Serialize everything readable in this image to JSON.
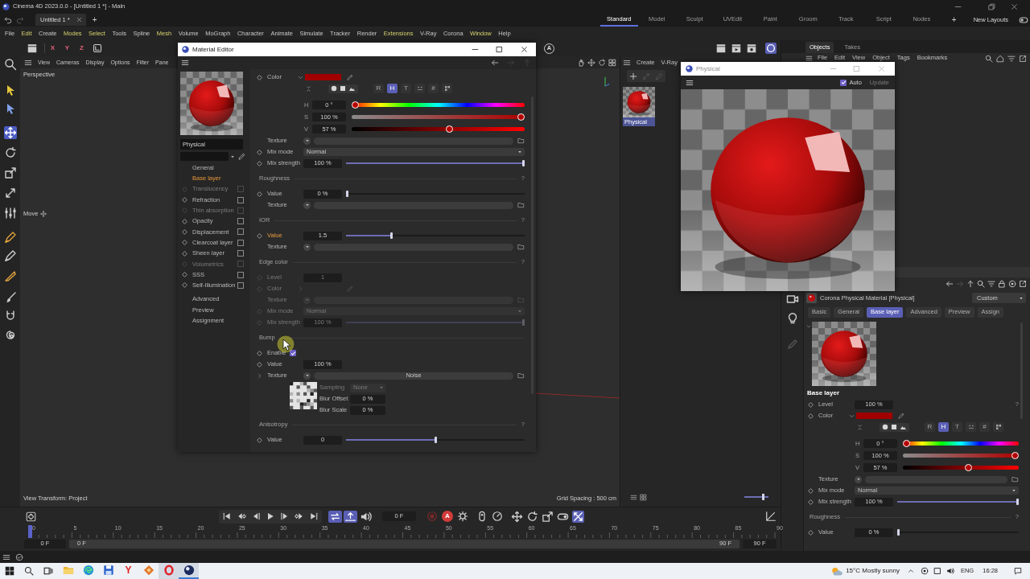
{
  "window": {
    "title": "Cinema 4D 2023.0.0 - [Untitled 1 *] - Main"
  },
  "document_tabs": [
    {
      "label": "Untitled 1 *",
      "selected": true
    }
  ],
  "new_tab": "+",
  "layouts": [
    {
      "label": "Standard",
      "selected": true
    },
    {
      "label": "Model",
      "selected": false
    },
    {
      "label": "Sculpt",
      "selected": false
    },
    {
      "label": "UVEdit",
      "selected": false
    },
    {
      "label": "Paint",
      "selected": false
    },
    {
      "label": "Groom",
      "selected": false
    },
    {
      "label": "Track",
      "selected": false
    },
    {
      "label": "Script",
      "selected": false
    },
    {
      "label": "Nodes",
      "selected": false
    }
  ],
  "add_layout": "+",
  "layout_menu": "New Layouts",
  "menu": [
    {
      "label": "File",
      "highlighted": false
    },
    {
      "label": "Edit",
      "highlighted": true
    },
    {
      "label": "Create",
      "highlighted": false
    },
    {
      "label": "Modes",
      "highlighted": true
    },
    {
      "label": "Select",
      "highlighted": true
    },
    {
      "label": "Tools",
      "highlighted": false
    },
    {
      "label": "Spline",
      "highlighted": false
    },
    {
      "label": "Mesh",
      "highlighted": true
    },
    {
      "label": "Volume",
      "highlighted": false
    },
    {
      "label": "MoGraph",
      "highlighted": false
    },
    {
      "label": "Character",
      "highlighted": false
    },
    {
      "label": "Animate",
      "highlighted": false
    },
    {
      "label": "Simulate",
      "highlighted": false
    },
    {
      "label": "Tracker",
      "highlighted": false
    },
    {
      "label": "Render",
      "highlighted": false
    },
    {
      "label": "Extensions",
      "highlighted": true
    },
    {
      "label": "V-Ray",
      "highlighted": false
    },
    {
      "label": "Corona",
      "highlighted": false
    },
    {
      "label": "Window",
      "highlighted": true
    },
    {
      "label": "Help",
      "highlighted": false
    }
  ],
  "toolbar": {
    "axes": [
      "X",
      "Y",
      "Z"
    ],
    "letter_button": "A",
    "render_tools": [
      {
        "on": false
      },
      {
        "on": false
      },
      {
        "on": false
      },
      {
        "on": true
      }
    ]
  },
  "tool_palette": [
    {
      "selected": false
    },
    {
      "selected": false
    },
    {
      "selected": false
    },
    {
      "selected": true
    },
    {
      "selected": false
    },
    {
      "selected": false
    },
    {
      "selected": false
    },
    {
      "selected": false
    },
    {
      "selected": false
    },
    {
      "selected": false
    },
    {
      "selected": false
    },
    {
      "selected": false
    },
    {
      "selected": false
    },
    {
      "selected": false
    }
  ],
  "viewport": {
    "menu": [
      "View",
      "Cameras",
      "Display",
      "Options",
      "Filter",
      "Pane"
    ],
    "camera": "Perspective",
    "active_tool": "Move",
    "view_transform": "View Transform: Project",
    "grid_spacing": "Grid Spacing : 500 cm"
  },
  "material_editor": {
    "title": "Material Editor",
    "name": "Physical",
    "sections": [
      {
        "kind": "page",
        "label": "General",
        "selected": false,
        "disabled": false
      },
      {
        "kind": "page",
        "label": "Base layer",
        "selected": true,
        "disabled": false
      },
      {
        "kind": "channel",
        "label": "Translucency",
        "checked": false,
        "selected": false,
        "disabled": true
      },
      {
        "kind": "channel",
        "label": "Refraction",
        "checked": false,
        "selected": false,
        "disabled": false
      },
      {
        "kind": "channel",
        "label": "Thin absorption",
        "checked": false,
        "selected": false,
        "disabled": true
      },
      {
        "kind": "channel",
        "label": "Opacity",
        "checked": false,
        "selected": false,
        "disabled": false
      },
      {
        "kind": "channel",
        "label": "Displacement",
        "checked": false,
        "selected": false,
        "disabled": false
      },
      {
        "kind": "channel",
        "label": "Clearcoat layer",
        "checked": false,
        "selected": false,
        "disabled": false
      },
      {
        "kind": "channel",
        "label": "Sheen layer",
        "checked": false,
        "selected": false,
        "disabled": false
      },
      {
        "kind": "channel",
        "label": "Volumetrics",
        "checked": false,
        "selected": false,
        "disabled": true
      },
      {
        "kind": "channel",
        "label": "SSS",
        "checked": false,
        "selected": false,
        "disabled": false
      },
      {
        "kind": "channel",
        "label": "Self-Illumination",
        "checked": false,
        "selected": false,
        "disabled": false
      },
      {
        "kind": "page",
        "label": "Advanced",
        "selected": false,
        "disabled": false
      },
      {
        "kind": "page",
        "label": "Preview",
        "selected": false,
        "disabled": false
      },
      {
        "kind": "page",
        "label": "Assignment",
        "selected": false,
        "disabled": false
      }
    ],
    "params": [
      {
        "kind": "color",
        "label": "Color",
        "color": "#a00000",
        "expanded": true,
        "disabled": false,
        "modified": false
      },
      {
        "kind": "modes",
        "buttons": [
          {
            "kind": "letter",
            "label": "R",
            "selected": false
          },
          {
            "kind": "letter",
            "label": "H",
            "selected": true
          },
          {
            "kind": "letter",
            "label": "T",
            "selected": false
          },
          {
            "kind": "icon",
            "selected": false
          },
          {
            "kind": "letter",
            "label": "#",
            "selected": false
          },
          {
            "kind": "icon",
            "selected": false
          }
        ]
      },
      {
        "kind": "hue_slider",
        "label": "H",
        "value": "0 °",
        "level": 0
      },
      {
        "kind": "saturation_slider",
        "label": "S",
        "value": "100 %",
        "level": 1
      },
      {
        "kind": "value_slider",
        "label": "V",
        "value": "57 %",
        "level": 0.57
      },
      {
        "kind": "texture",
        "label": "Texture",
        "disabled": false,
        "modified": false
      },
      {
        "kind": "dropdown",
        "label": "Mix mode",
        "value": "Normal",
        "disabled": false,
        "modified": false
      },
      {
        "kind": "slider",
        "label": "Mix strength",
        "value": "100 %",
        "level": 1,
        "disabled": false,
        "modified": false
      },
      {
        "kind": "section",
        "label": "Roughness",
        "help": "?"
      },
      {
        "kind": "slider",
        "label": "Value",
        "value": "0 %",
        "level": 0,
        "disabled": false,
        "modified": false
      },
      {
        "kind": "texture",
        "label": "Texture",
        "disabled": false,
        "modified": false
      },
      {
        "kind": "section",
        "label": "IOR",
        "help": "?"
      },
      {
        "kind": "slider",
        "label": "Value",
        "value": "1.5",
        "level": 0.25,
        "disabled": false,
        "modified": true
      },
      {
        "kind": "texture",
        "label": "Texture",
        "disabled": false,
        "modified": false
      },
      {
        "kind": "section",
        "label": "Edge color",
        "help": "?"
      },
      {
        "kind": "field",
        "label": "Level",
        "value": "1",
        "disabled": true,
        "modified": false
      },
      {
        "kind": "color",
        "label": "Color",
        "expanded": false,
        "disabled": true,
        "modified": false
      },
      {
        "kind": "texture",
        "label": "Texture",
        "disabled": true,
        "modified": false
      },
      {
        "kind": "dropdown",
        "label": "Mix mode",
        "value": "Normal",
        "disabled": true,
        "modified": false
      },
      {
        "kind": "slider",
        "label": "Mix strength",
        "value": "100 %",
        "level": 1,
        "disabled": true,
        "modified": false
      },
      {
        "kind": "section",
        "label": "Bump"
      },
      {
        "kind": "checkbox",
        "label": "Enable",
        "checked": true,
        "disabled": false,
        "modified": false
      },
      {
        "kind": "field",
        "label": "Value",
        "value": "100 %",
        "disabled": false,
        "modified": false
      },
      {
        "kind": "texture",
        "label": "Texture",
        "value": "Noise",
        "expanded": false,
        "disabled": false,
        "modified": false
      },
      {
        "kind": "noise",
        "fields": [
          {
            "kind": "dropdown",
            "label": "Sampling",
            "value": "None",
            "disabled": true
          },
          {
            "kind": "field",
            "label": "Blur Offset",
            "value": "0 %",
            "disabled": false
          },
          {
            "kind": "field",
            "label": "Blur Scale",
            "value": "0 %",
            "disabled": false
          }
        ]
      },
      {
        "kind": "section",
        "label": "Anisotropy",
        "help": "?"
      },
      {
        "kind": "slider",
        "label": "Value",
        "value": "0",
        "level": 0.5,
        "disabled": false,
        "modified": false
      }
    ]
  },
  "material_manager": {
    "menu": [
      "Create",
      "V-Ray"
    ],
    "materials": [
      {
        "name": "Physical",
        "selected": true
      }
    ],
    "zoom": {
      "level": 0.8
    }
  },
  "objects_panel": {
    "tabs": [
      {
        "label": "Objects",
        "selected": true
      },
      {
        "label": "Takes",
        "selected": false
      }
    ],
    "menu": [
      "File",
      "Edit",
      "View",
      "Object",
      "Tags",
      "Bookmarks"
    ]
  },
  "preview_window": {
    "title": "Physical",
    "auto": {
      "label": "Auto",
      "checked": true
    },
    "update": {
      "label": "Update",
      "disabled": true
    }
  },
  "attributes": {
    "title": "Corona Physical Material [Physical]",
    "mode": "Custom",
    "tabs": [
      {
        "label": "Basic",
        "selected": false
      },
      {
        "label": "General",
        "selected": false
      },
      {
        "label": "Base layer",
        "selected": true
      },
      {
        "label": "Advanced",
        "selected": false
      },
      {
        "label": "Preview",
        "selected": false
      },
      {
        "label": "Assign",
        "selected": false
      }
    ],
    "heading": "Base layer",
    "params": [
      {
        "kind": "field",
        "label": "Level",
        "value": "100 %",
        "help": "?",
        "disabled": false,
        "modified": false
      },
      {
        "kind": "color",
        "label": "Color",
        "color": "#a00000",
        "expanded": true,
        "disabled": false,
        "modified": false
      },
      {
        "kind": "modes",
        "buttons": [
          {
            "kind": "letter",
            "label": "R",
            "selected": false
          },
          {
            "kind": "letter",
            "label": "H",
            "selected": true
          },
          {
            "kind": "letter",
            "label": "T",
            "selected": false
          },
          {
            "kind": "icon",
            "selected": false
          },
          {
            "kind": "letter",
            "label": "#",
            "selected": false
          },
          {
            "kind": "icon",
            "selected": false
          }
        ]
      },
      {
        "kind": "hue_slider",
        "label": "H",
        "value": "0 °",
        "level": 0
      },
      {
        "kind": "saturation_slider",
        "label": "S",
        "value": "100 %",
        "level": 1
      },
      {
        "kind": "value_slider",
        "label": "V",
        "value": "57 %",
        "level": 0.57
      },
      {
        "kind": "texture",
        "label": "Texture",
        "disabled": false,
        "modified": false
      },
      {
        "kind": "dropdown",
        "label": "Mix mode",
        "value": "Normal",
        "disabled": false,
        "modified": false
      },
      {
        "kind": "slider",
        "label": "Mix strength",
        "value": "100 %",
        "level": 1,
        "disabled": false,
        "modified": false
      },
      {
        "kind": "section",
        "label": "Roughness",
        "help": "?"
      },
      {
        "kind": "slider",
        "label": "Value",
        "value": "0 %",
        "level": 0,
        "disabled": false,
        "modified": false
      }
    ]
  },
  "timeline": {
    "toggles": [
      {
        "on": true
      },
      {
        "on": true
      },
      {
        "on": false
      }
    ],
    "frame": "0 F",
    "autokey": "A",
    "key_tools": [
      {
        "on": false
      },
      {
        "on": false
      },
      {
        "on": false
      },
      {
        "on": false
      },
      {
        "on": true
      }
    ],
    "ruler": [
      "0",
      "5",
      "10",
      "15",
      "20",
      "25",
      "30",
      "35",
      "40",
      "45",
      "50",
      "55",
      "60",
      "65",
      "70",
      "75",
      "80",
      "85",
      "90"
    ],
    "playhead": {
      "level": 0
    },
    "start": "0 F",
    "range_start": "0 F",
    "range_end": "90 F",
    "end": "90 F"
  },
  "taskbar": {
    "apps": [
      {
        "active": false,
        "highlighted": false
      },
      {
        "active": false,
        "highlighted": false
      },
      {
        "active": false,
        "highlighted": false
      },
      {
        "label": "Y",
        "active": false,
        "highlighted": false
      },
      {
        "active": false,
        "highlighted": false
      },
      {
        "active": false,
        "highlighted": true
      },
      {
        "active": true,
        "highlighted": true
      }
    ],
    "weather": "15°C Mostly sunny",
    "language": "ENG",
    "time": "16:28"
  }
}
